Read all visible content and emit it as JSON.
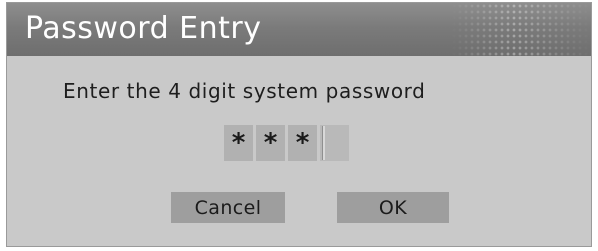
{
  "dialog": {
    "title": "Password Entry",
    "prompt": "Enter the 4 digit system password",
    "password": {
      "mask_char": "*",
      "total_digits": 4,
      "entered_digits": 3,
      "slots": [
        "*",
        "*",
        "*",
        ""
      ]
    },
    "buttons": {
      "cancel_label": "Cancel",
      "ok_label": "OK"
    }
  },
  "colors": {
    "title_bar": "#7b7b7b",
    "dialog_background": "#c9c9c9",
    "button_background": "#9e9e9e",
    "title_text": "#ffffff"
  }
}
